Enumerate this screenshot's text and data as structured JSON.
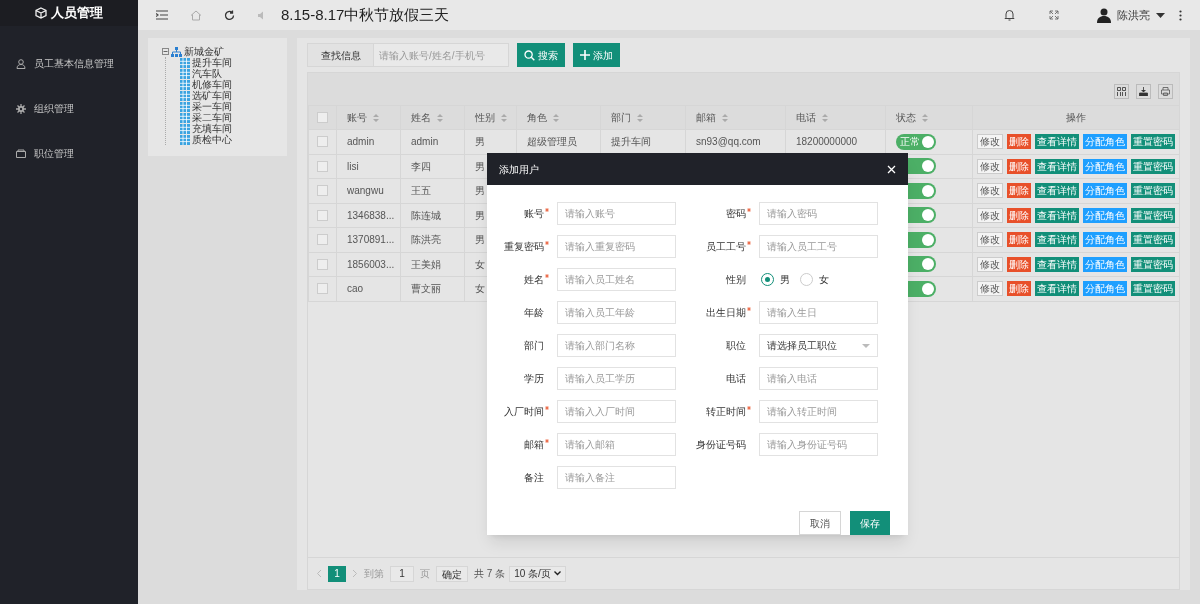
{
  "app_title": "人员管理",
  "sidebar": {
    "items": [
      {
        "label": "员工基本信息管理",
        "kind": "user"
      },
      {
        "label": "组织管理",
        "kind": "gear"
      },
      {
        "label": "职位管理",
        "kind": "card"
      }
    ]
  },
  "header": {
    "notice": "8.15-8.17中秋节放假三天",
    "user": "陈洪亮"
  },
  "tree": {
    "label": "新城金矿",
    "expanded": true,
    "children": [
      {
        "label": "提升车间"
      },
      {
        "label": "汽车队"
      },
      {
        "label": "机修车间"
      },
      {
        "label": "选矿车间"
      },
      {
        "label": "采一车间"
      },
      {
        "label": "采二车间"
      },
      {
        "label": "充填车间"
      },
      {
        "label": "质检中心"
      }
    ]
  },
  "search": {
    "label": "查找信息",
    "placeholder": "请输入账号/姓名/手机号",
    "search_button": "搜索",
    "add_button": "添加"
  },
  "table": {
    "all_checked": false,
    "columns": [
      {
        "label": "账号",
        "sortable": true
      },
      {
        "label": "姓名",
        "sortable": true
      },
      {
        "label": "性别",
        "sortable": true
      },
      {
        "label": "角色",
        "sortable": true
      },
      {
        "label": "部门",
        "sortable": true
      },
      {
        "label": "邮箱",
        "sortable": true
      },
      {
        "label": "电话",
        "sortable": true
      },
      {
        "label": "状态",
        "sortable": true
      },
      {
        "label": "操作",
        "sortable": false
      }
    ],
    "rows": [
      {
        "checked": false,
        "cells": [
          "admin",
          "admin",
          "男",
          "超级管理员",
          "提升车间",
          "sn93@qq.com",
          "18200000000"
        ],
        "status": {
          "on": true,
          "label": "正常"
        },
        "actions": [
          {
            "label": "修改",
            "kind": "plain"
          },
          {
            "label": "删除",
            "kind": "danger"
          },
          {
            "label": "查看详情",
            "kind": "primary"
          },
          {
            "label": "分配角色",
            "kind": "info"
          },
          {
            "label": "重置密码",
            "kind": "primary"
          }
        ]
      },
      {
        "checked": false,
        "cells": [
          "lisi",
          "李四",
          "男"
        ],
        "status": {
          "on": true
        },
        "actions": [
          {
            "label": "修改",
            "kind": "plain"
          },
          {
            "label": "删除",
            "kind": "danger"
          },
          {
            "label": "查看详情",
            "kind": "primary"
          },
          {
            "label": "分配角色",
            "kind": "info"
          },
          {
            "label": "重置密码",
            "kind": "primary"
          }
        ]
      },
      {
        "checked": false,
        "cells": [
          "wangwu",
          "王五",
          "男"
        ],
        "status": {
          "on": true
        },
        "actions": [
          {
            "label": "修改",
            "kind": "plain"
          },
          {
            "label": "删除",
            "kind": "danger"
          },
          {
            "label": "查看详情",
            "kind": "primary"
          },
          {
            "label": "分配角色",
            "kind": "info"
          },
          {
            "label": "重置密码",
            "kind": "primary"
          }
        ]
      },
      {
        "checked": false,
        "cells": [
          "1346838...",
          "陈连城",
          "男"
        ],
        "status": {
          "on": true
        },
        "actions": [
          {
            "label": "修改",
            "kind": "plain"
          },
          {
            "label": "删除",
            "kind": "danger"
          },
          {
            "label": "查看详情",
            "kind": "primary"
          },
          {
            "label": "分配角色",
            "kind": "info"
          },
          {
            "label": "重置密码",
            "kind": "primary"
          }
        ]
      },
      {
        "checked": false,
        "cells": [
          "1370891...",
          "陈洪亮",
          "男"
        ],
        "status": {
          "on": true
        },
        "actions": [
          {
            "label": "修改",
            "kind": "plain"
          },
          {
            "label": "删除",
            "kind": "danger"
          },
          {
            "label": "查看详情",
            "kind": "primary"
          },
          {
            "label": "分配角色",
            "kind": "info"
          },
          {
            "label": "重置密码",
            "kind": "primary"
          }
        ]
      },
      {
        "checked": false,
        "cells": [
          "1856003...",
          "王美娟",
          "女"
        ],
        "status": {
          "on": true
        },
        "actions": [
          {
            "label": "修改",
            "kind": "plain"
          },
          {
            "label": "删除",
            "kind": "danger"
          },
          {
            "label": "查看详情",
            "kind": "primary"
          },
          {
            "label": "分配角色",
            "kind": "info"
          },
          {
            "label": "重置密码",
            "kind": "primary"
          }
        ]
      },
      {
        "checked": false,
        "cells": [
          "cao",
          "曹文丽",
          "女"
        ],
        "status": {
          "on": true
        },
        "actions": [
          {
            "label": "修改",
            "kind": "plain"
          },
          {
            "label": "删除",
            "kind": "danger"
          },
          {
            "label": "查看详情",
            "kind": "primary"
          },
          {
            "label": "分配角色",
            "kind": "info"
          },
          {
            "label": "重置密码",
            "kind": "primary"
          }
        ]
      }
    ]
  },
  "pagination": {
    "pages": [
      {
        "label": "1",
        "selected": true
      }
    ],
    "goto_label": "到第",
    "page_value": "1",
    "page_unit": "页",
    "confirm": "确定",
    "total": "共 7 条",
    "page_size": "10 条/页"
  },
  "dialog": {
    "title": "添加用户",
    "fields": [
      {
        "label": "账号",
        "required": true,
        "kind": "input",
        "placeholder": "请输入账号"
      },
      {
        "label": "密码",
        "required": true,
        "kind": "input",
        "placeholder": "请输入密码"
      },
      {
        "label": "重复密码",
        "required": true,
        "kind": "input",
        "placeholder": "请输入重复密码"
      },
      {
        "label": "员工工号",
        "required": true,
        "kind": "input",
        "placeholder": "请输入员工工号"
      },
      {
        "label": "姓名",
        "required": true,
        "kind": "input",
        "placeholder": "请输入员工姓名"
      },
      {
        "label": "性别",
        "required": false,
        "kind": "radio",
        "options": [
          {
            "label": "男",
            "selected": true
          },
          {
            "label": "女",
            "selected": false
          }
        ]
      },
      {
        "label": "年龄",
        "required": false,
        "kind": "input",
        "placeholder": "请输入员工年龄"
      },
      {
        "label": "出生日期",
        "required": true,
        "kind": "input",
        "placeholder": "请输入生日"
      },
      {
        "label": "部门",
        "required": false,
        "kind": "input",
        "placeholder": "请输入部门名称"
      },
      {
        "label": "职位",
        "required": false,
        "kind": "select",
        "value": "请选择员工职位"
      },
      {
        "label": "学历",
        "required": false,
        "kind": "input",
        "placeholder": "请输入员工学历"
      },
      {
        "label": "电话",
        "required": false,
        "kind": "input",
        "placeholder": "请输入电话"
      },
      {
        "label": "入厂时间",
        "required": true,
        "kind": "input",
        "placeholder": "请输入入厂时间"
      },
      {
        "label": "转正时间",
        "required": true,
        "kind": "input",
        "placeholder": "请输入转正时间"
      },
      {
        "label": "邮箱",
        "required": true,
        "kind": "input",
        "placeholder": "请输入邮箱"
      },
      {
        "label": "身份证号码",
        "required": false,
        "kind": "input",
        "placeholder": "请输入身份证号码"
      },
      {
        "label": "备注",
        "required": false,
        "kind": "input",
        "placeholder": "请输入备注"
      }
    ],
    "cancel_button": "取消",
    "save_button": "保存"
  }
}
